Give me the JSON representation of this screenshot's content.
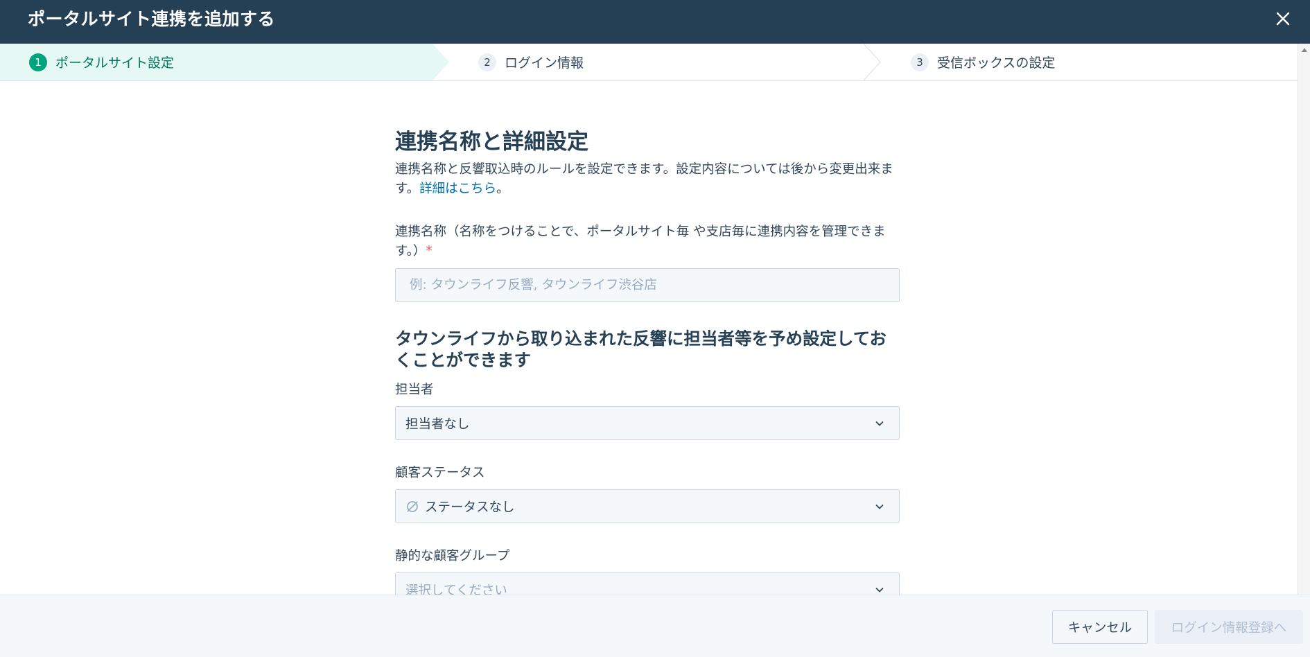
{
  "header": {
    "title": "ポータルサイト連携を追加する"
  },
  "stepper": {
    "steps": [
      {
        "number": "1",
        "label": "ポータルサイト設定",
        "active": true
      },
      {
        "number": "2",
        "label": "ログイン情報",
        "active": false
      },
      {
        "number": "3",
        "label": "受信ボックスの設定",
        "active": false
      }
    ]
  },
  "main": {
    "section_title": "連携名称と詳細設定",
    "description": "連携名称と反響取込時のルールを設定できます。設定内容については後から変更出来ます。",
    "description_link": "詳細はこちら",
    "description_end": "。",
    "name_field": {
      "label": "連携名称（名称をつけることで、ポータルサイト毎 や支店毎に連携内容を管理できます。）",
      "required_mark": "*",
      "placeholder": "例: タウンライフ反響, タウンライフ渋谷店",
      "value": ""
    },
    "subsection_title": "タウンライフから取り込まれた反響に担当者等を予め設定しておくことができます",
    "assignee_field": {
      "label": "担当者",
      "value": "担当者なし"
    },
    "status_field": {
      "label": "顧客ステータス",
      "value": "ステータスなし"
    },
    "group_field": {
      "label": "静的な顧客グループ",
      "placeholder": "選択してください"
    }
  },
  "footer": {
    "cancel_label": "キャンセル",
    "next_label": "ログイン情報登録へ"
  },
  "colors": {
    "header_bg": "#253f55",
    "active_step_bg": "#e5f8f3",
    "active_step_accent": "#00a37c",
    "link": "#0073ae",
    "required": "#f2545b"
  }
}
